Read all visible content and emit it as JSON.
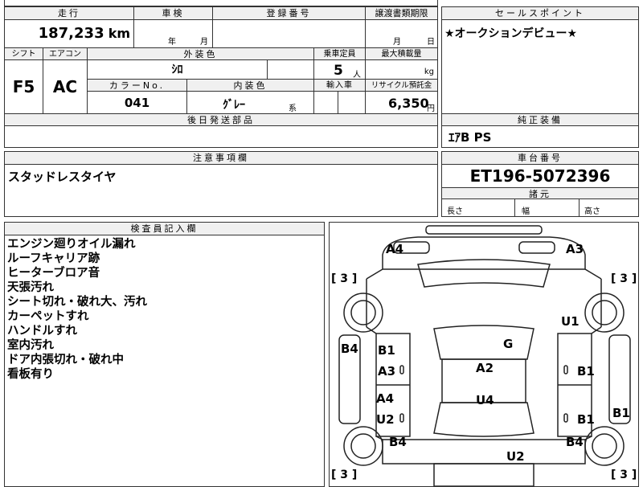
{
  "top": {
    "mileage_header": "走行",
    "mileage_value": "187,233",
    "mileage_unit": "km",
    "inspection_header": "車検",
    "inspection_year": "年",
    "inspection_month": "月",
    "registration_header": "登録番号",
    "transfer_header": "譲渡書類期限",
    "transfer_month": "月",
    "transfer_day": "日"
  },
  "specs": {
    "shift_header": "シフト",
    "shift_value": "F5",
    "aircon_header": "エアコン",
    "aircon_value": "AC",
    "exterior_color_header": "外装色",
    "exterior_color_value": "ｼﾛ",
    "capacity_header": "乗車定員",
    "capacity_value": "5",
    "capacity_unit": "人",
    "max_load_header": "最大積載量",
    "max_load_unit": "kg",
    "color_no_header": "カラーNo.",
    "color_no_value": "041",
    "interior_color_header": "内装色",
    "interior_color_value": "ｸﾞﾚｰ",
    "interior_color_suffix": "系",
    "import_header": "輸入車",
    "recycle_header": "リサイクル預託金",
    "recycle_value": "6,350",
    "recycle_unit": "円",
    "later_parts_header": "後日発送部品"
  },
  "sales_point": {
    "header": "セールスポイント",
    "text": "★オークションデビュー★"
  },
  "equipment": {
    "header": "純正装備",
    "text": "ｴｱB PS"
  },
  "notes": {
    "header": "注意事項欄",
    "text": "スタッドレスタイヤ"
  },
  "chassis": {
    "header": "車台番号",
    "value": "ET196-5072396",
    "dims_header": "諸元",
    "length_label": "長さ",
    "width_label": "幅",
    "height_label": "高さ"
  },
  "inspector": {
    "header": "検査員記入欄",
    "lines": [
      "エンジン廻りオイル漏れ",
      "ルーフキャリア跡",
      "ヒーターブロア音",
      "天張汚れ",
      "シート切れ・破れ大、汚れ",
      "カーペットすれ",
      "ハンドルすれ",
      "室内汚れ",
      "ドア内張切れ・破れ中",
      "看板有り"
    ]
  },
  "diagram": {
    "tire_marks": [
      "[ 3 ]",
      "[ 3 ]",
      "[ 3 ]",
      "[ 3 ]"
    ],
    "labels": [
      "A4",
      "A3",
      "U1",
      "B4",
      "B1",
      "A3",
      "G",
      "A2",
      "B1",
      "A4",
      "U2",
      "U4",
      "B1",
      "B1",
      "B4",
      "U2",
      "B4"
    ]
  }
}
